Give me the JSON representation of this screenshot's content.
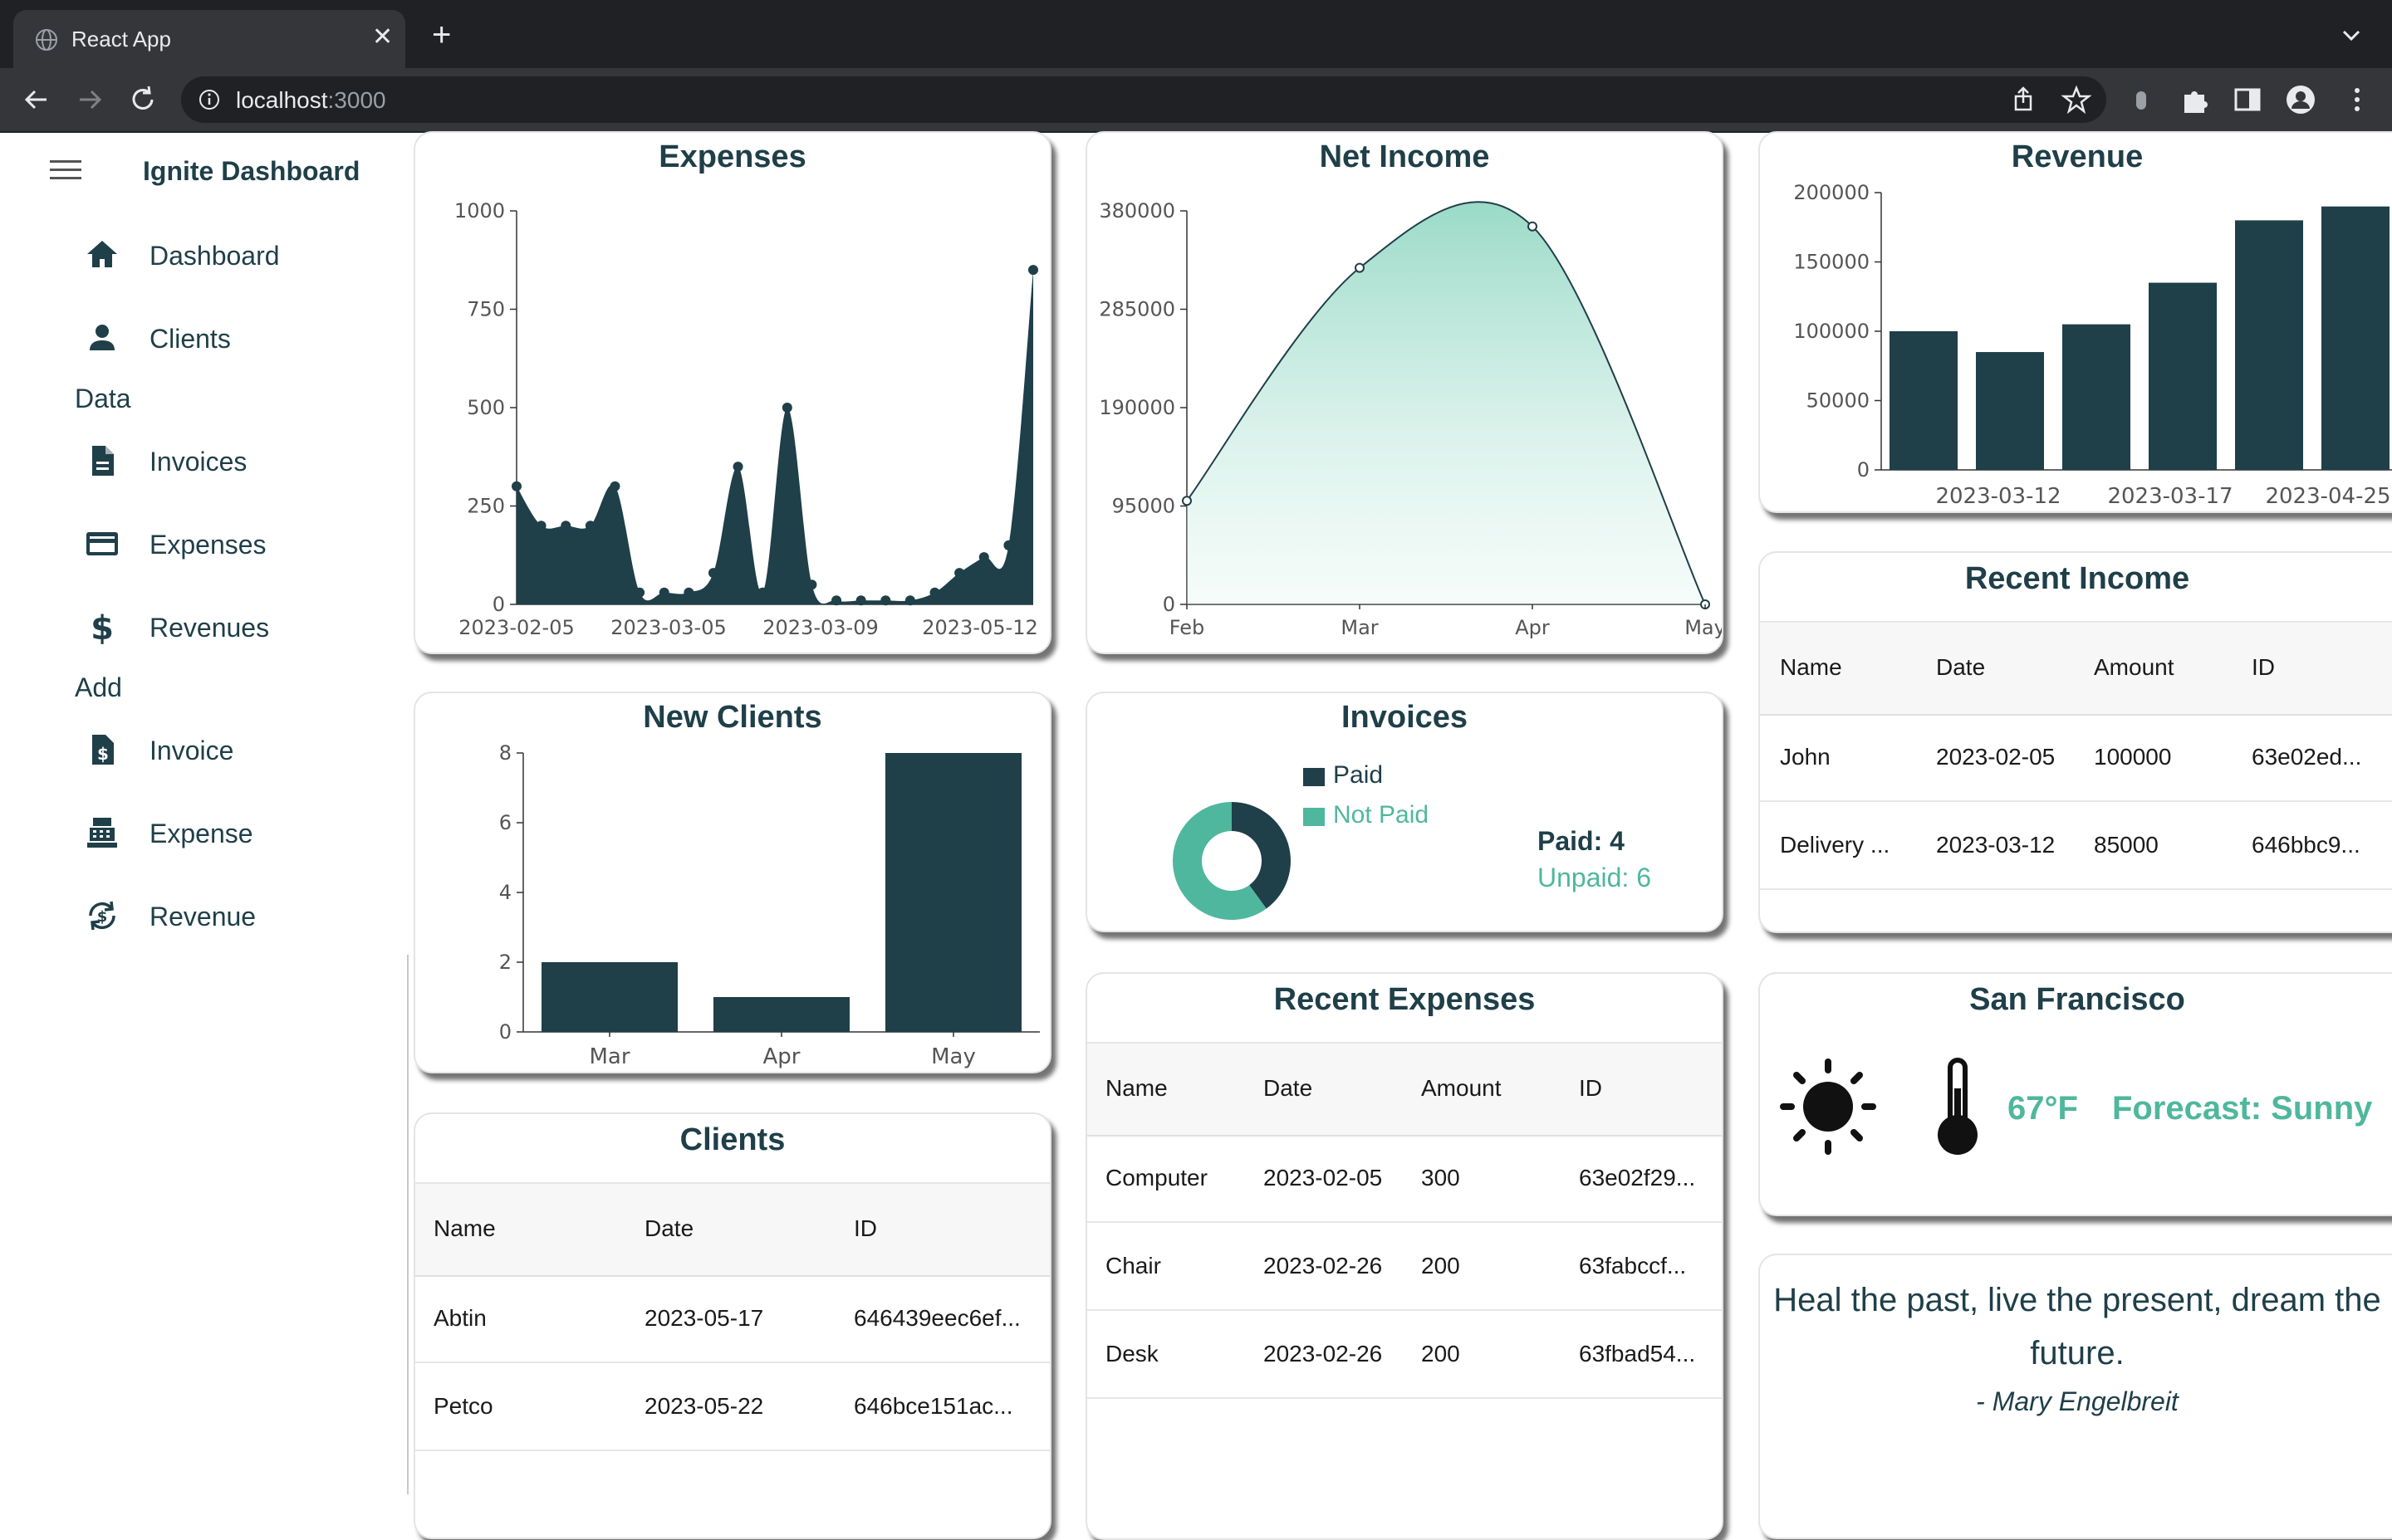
{
  "browser": {
    "tab_title": "React App",
    "url_host": "localhost",
    "url_port": ":3000"
  },
  "sidebar": {
    "brand": "Ignite Dashboard",
    "items": [
      {
        "label": "Dashboard",
        "icon": "home-icon"
      },
      {
        "label": "Clients",
        "icon": "person-icon"
      }
    ],
    "data_section": "Data",
    "data_items": [
      {
        "label": "Invoices",
        "icon": "document-icon"
      },
      {
        "label": "Expenses",
        "icon": "credit-card-icon"
      },
      {
        "label": "Revenues",
        "icon": "dollar-icon"
      }
    ],
    "add_section": "Add",
    "add_items": [
      {
        "label": "Invoice",
        "icon": "invoice-icon"
      },
      {
        "label": "Expense",
        "icon": "register-icon"
      },
      {
        "label": "Revenue",
        "icon": "currency-exchange-icon"
      }
    ]
  },
  "colors": {
    "primary": "#1f3f49",
    "accent": "#4fb79d"
  },
  "cards": {
    "expenses_title": "Expenses",
    "net_income_title": "Net Income",
    "revenue_title": "Revenue",
    "new_clients_title": "New Clients",
    "invoices_title": "Invoices",
    "recent_income_title": "Recent Income",
    "recent_expenses_title": "Recent Expenses",
    "clients_title": "Clients",
    "weather_title": "San Francisco"
  },
  "chart_data": [
    {
      "id": "expenses",
      "type": "area",
      "title": "Expenses",
      "ylim": [
        0,
        1000
      ],
      "yticks": [
        0,
        250,
        500,
        750,
        1000
      ],
      "xtick_labels": [
        "2023-02-05",
        "2023-03-05",
        "2023-03-09",
        "2023-05-12"
      ],
      "values": [
        300,
        200,
        200,
        200,
        300,
        30,
        30,
        30,
        80,
        350,
        30,
        500,
        50,
        10,
        10,
        10,
        10,
        30,
        80,
        120,
        150,
        850
      ]
    },
    {
      "id": "net_income",
      "type": "area",
      "title": "Net Income",
      "ylim": [
        0,
        380000
      ],
      "yticks": [
        0,
        95000,
        190000,
        285000,
        380000
      ],
      "categories": [
        "Feb",
        "Mar",
        "Apr",
        "May"
      ],
      "values": [
        100000,
        325000,
        365000,
        0
      ]
    },
    {
      "id": "revenue",
      "type": "bar",
      "title": "Revenue",
      "ylim": [
        0,
        200000
      ],
      "yticks": [
        0,
        50000,
        100000,
        150000,
        200000
      ],
      "xtick_labels": [
        "2023-03-12",
        "2023-03-17",
        "2023-04-25"
      ],
      "values": [
        100000,
        85000,
        105000,
        135000,
        180000,
        190000
      ]
    },
    {
      "id": "new_clients",
      "type": "bar",
      "title": "New Clients",
      "ylim": [
        0,
        8
      ],
      "yticks": [
        0,
        2,
        4,
        6,
        8
      ],
      "categories": [
        "Mar",
        "Apr",
        "May"
      ],
      "values": [
        2,
        1,
        8
      ]
    },
    {
      "id": "invoices",
      "type": "pie",
      "title": "Invoices",
      "legend": [
        "Paid",
        "Not Paid"
      ],
      "values": [
        4,
        6
      ]
    }
  ],
  "invoices_summary": {
    "paid": "Paid: 4",
    "unpaid": "Unpaid: 6"
  },
  "recent_income": {
    "columns": [
      "Name",
      "Date",
      "Amount",
      "ID"
    ],
    "rows": [
      [
        "John",
        "2023-02-05",
        "100000",
        "63e02ed..."
      ],
      [
        "Delivery ...",
        "2023-03-12",
        "85000",
        "646bbc9..."
      ]
    ]
  },
  "recent_expenses": {
    "columns": [
      "Name",
      "Date",
      "Amount",
      "ID"
    ],
    "rows": [
      [
        "Computer",
        "2023-02-05",
        "300",
        "63e02f29..."
      ],
      [
        "Chair",
        "2023-02-26",
        "200",
        "63fabccf..."
      ],
      [
        "Desk",
        "2023-02-26",
        "200",
        "63fbad54..."
      ]
    ]
  },
  "clients": {
    "columns": [
      "Name",
      "Date",
      "ID"
    ],
    "rows": [
      [
        "Abtin",
        "2023-05-17",
        "646439eec6ef..."
      ],
      [
        "Petco",
        "2023-05-22",
        "646bce151ac..."
      ]
    ]
  },
  "weather": {
    "temp": "67°F",
    "forecast": "Forecast: Sunny"
  },
  "quote": {
    "text": "Heal the past, live the present, dream the future.",
    "author": "- Mary Engelbreit"
  }
}
